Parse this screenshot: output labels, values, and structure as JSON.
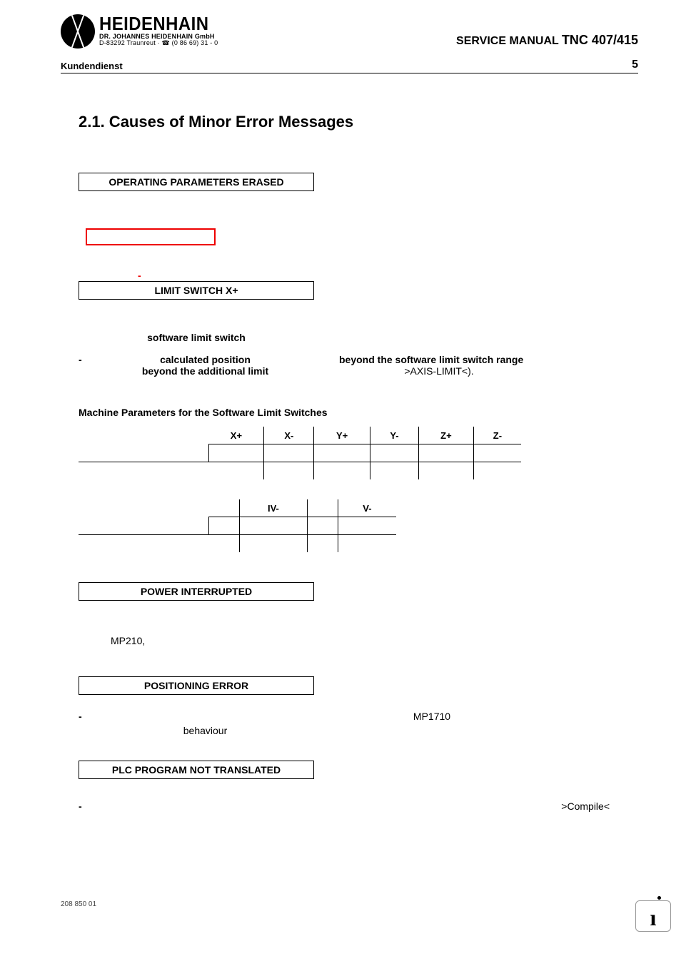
{
  "header": {
    "logo_name": "HEIDENHAIN",
    "logo_sub1": "DR. JOHANNES HEIDENHAIN GmbH",
    "logo_sub2": "D-83292 Traunreut · ☎ (0 86 69) 31 - 0",
    "manual": "SERVICE MANUAL",
    "model": "TNC 407/415",
    "kundendienst": "Kundendienst",
    "page_number": "5"
  },
  "section": {
    "title": "2.1. Causes of Minor Error Messages",
    "box1": "OPERATING PARAMETERS ERASED",
    "box2": "LIMIT SWITCH X+",
    "sls_label": "software limit switch",
    "calc_pos": "calculated position",
    "beyond_additional": "beyond the additional limit",
    "beyond_software": "beyond the software limit switch range",
    "axis_limit": ">AXIS-LIMIT<).",
    "table_heading": "Machine Parameters for the Software Limit Switches",
    "box3": "POWER INTERRUPTED",
    "mp210": "MP210,",
    "box4": "POSITIONING ERROR",
    "mp1710": "MP1710",
    "behaviour": "behaviour",
    "box5": "PLC PROGRAM NOT TRANSLATED",
    "compile": ">Compile<"
  },
  "table1": {
    "headers": [
      "X+",
      "X-",
      "Y+",
      "Y-",
      "Z+",
      "Z-"
    ]
  },
  "table2": {
    "headers": [
      "",
      "IV-",
      "",
      "V-"
    ]
  },
  "footer": {
    "code": "208 850 01",
    "info": "i"
  }
}
